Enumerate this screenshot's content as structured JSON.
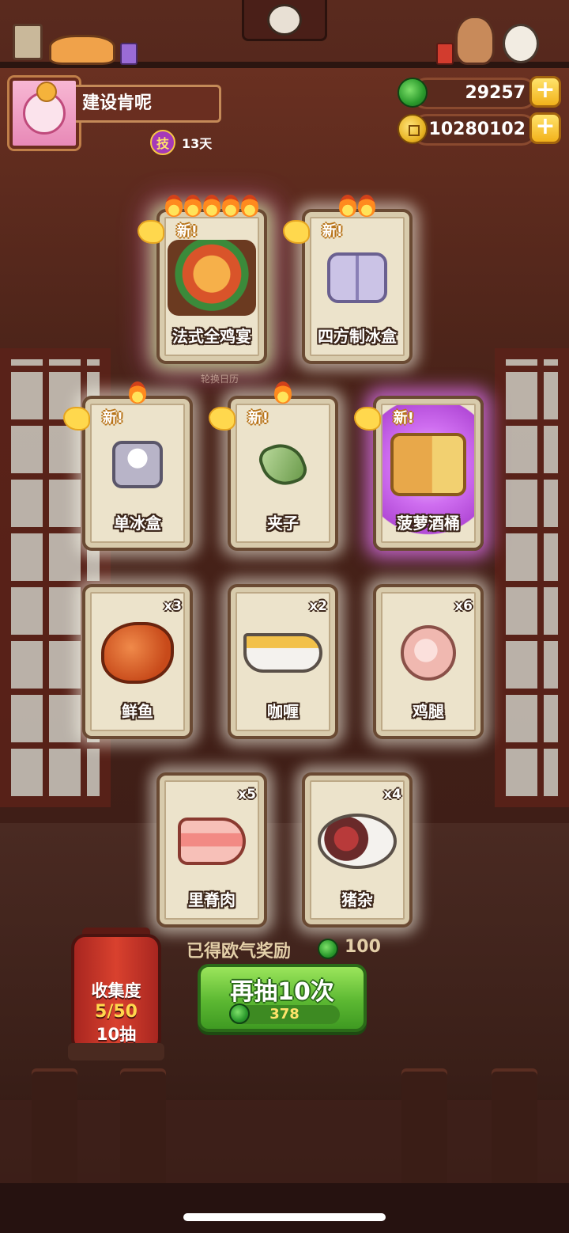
{
  "profile": {
    "name": "建设肯呢",
    "skill_label": "技",
    "skill_days": "13天"
  },
  "currencies": {
    "jade": "29257",
    "coins": "10280102"
  },
  "watermark": "轮换日历",
  "new_label": "新!",
  "cards": [
    {
      "name": "法式全鸡宴",
      "is_new": true,
      "flames": 5,
      "qty": "",
      "glow": "rainbow"
    },
    {
      "name": "四方制冰盒",
      "is_new": true,
      "flames": 2,
      "qty": "",
      "glow": "white"
    },
    {
      "name": "单冰盒",
      "is_new": true,
      "flames": 1,
      "qty": "",
      "glow": "white"
    },
    {
      "name": "夹子",
      "is_new": true,
      "flames": 1,
      "qty": "",
      "glow": "white"
    },
    {
      "name": "菠萝酒桶",
      "is_new": true,
      "flames": 0,
      "qty": "",
      "glow": "purple"
    },
    {
      "name": "鲜鱼",
      "is_new": false,
      "flames": 0,
      "qty": "x3",
      "glow": "white"
    },
    {
      "name": "咖喱",
      "is_new": false,
      "flames": 0,
      "qty": "x2",
      "glow": "white"
    },
    {
      "name": "鸡腿",
      "is_new": false,
      "flames": 0,
      "qty": "x6",
      "glow": "white"
    },
    {
      "name": "里脊肉",
      "is_new": false,
      "flames": 0,
      "qty": "x5",
      "glow": "white"
    },
    {
      "name": "猪杂",
      "is_new": false,
      "flames": 0,
      "qty": "x4",
      "glow": "white"
    }
  ],
  "reward": {
    "label": "已得欧气奖励",
    "value": "100"
  },
  "draw_button": {
    "label": "再抽10次",
    "cost": "378"
  },
  "collection": {
    "title": "收集度",
    "progress": "5/50",
    "draws": "10抽"
  },
  "colors": {
    "accent_green": "#5cb832",
    "gold": "#ffd84d",
    "wood": "#6a2e20"
  }
}
